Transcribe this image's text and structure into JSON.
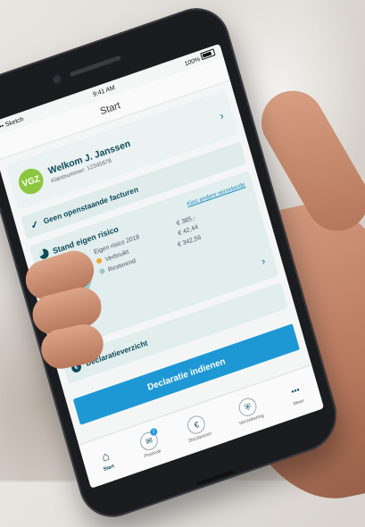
{
  "status_bar": {
    "carrier": "•••• Sketch",
    "time": "9:41 AM",
    "battery": "100%"
  },
  "nav": {
    "title": "Start"
  },
  "welcome": {
    "logo": "VGZ",
    "greeting": "Welkom J. Janssen",
    "klantnummer": "Klantnummer: 12345678"
  },
  "status_row": {
    "text": "Geen openstaande facturen"
  },
  "risk": {
    "title": "Stand eigen risico",
    "link": "Kies andere verzekerde",
    "label_total": "Eigen risico 2018",
    "value_total": "€ 385,-",
    "label_used": "Verbruikt",
    "value_used": "€ 42,44",
    "label_rest": "Resterend",
    "value_rest": "€ 342,56",
    "colors": {
      "used": "#f2a531",
      "rest": "#9cc7c9"
    }
  },
  "declaratie": {
    "overview": "Declaratieverzicht",
    "cta": "Declaratie indienen"
  },
  "tabs": [
    {
      "label": "Start",
      "icon": "home-icon"
    },
    {
      "label": "Postvak",
      "icon": "mail-icon",
      "badge": "2"
    },
    {
      "label": "Declareren",
      "icon": "euro-icon"
    },
    {
      "label": "Verzekering",
      "icon": "shield-icon"
    },
    {
      "label": "Meer",
      "icon": "more-icon"
    }
  ]
}
